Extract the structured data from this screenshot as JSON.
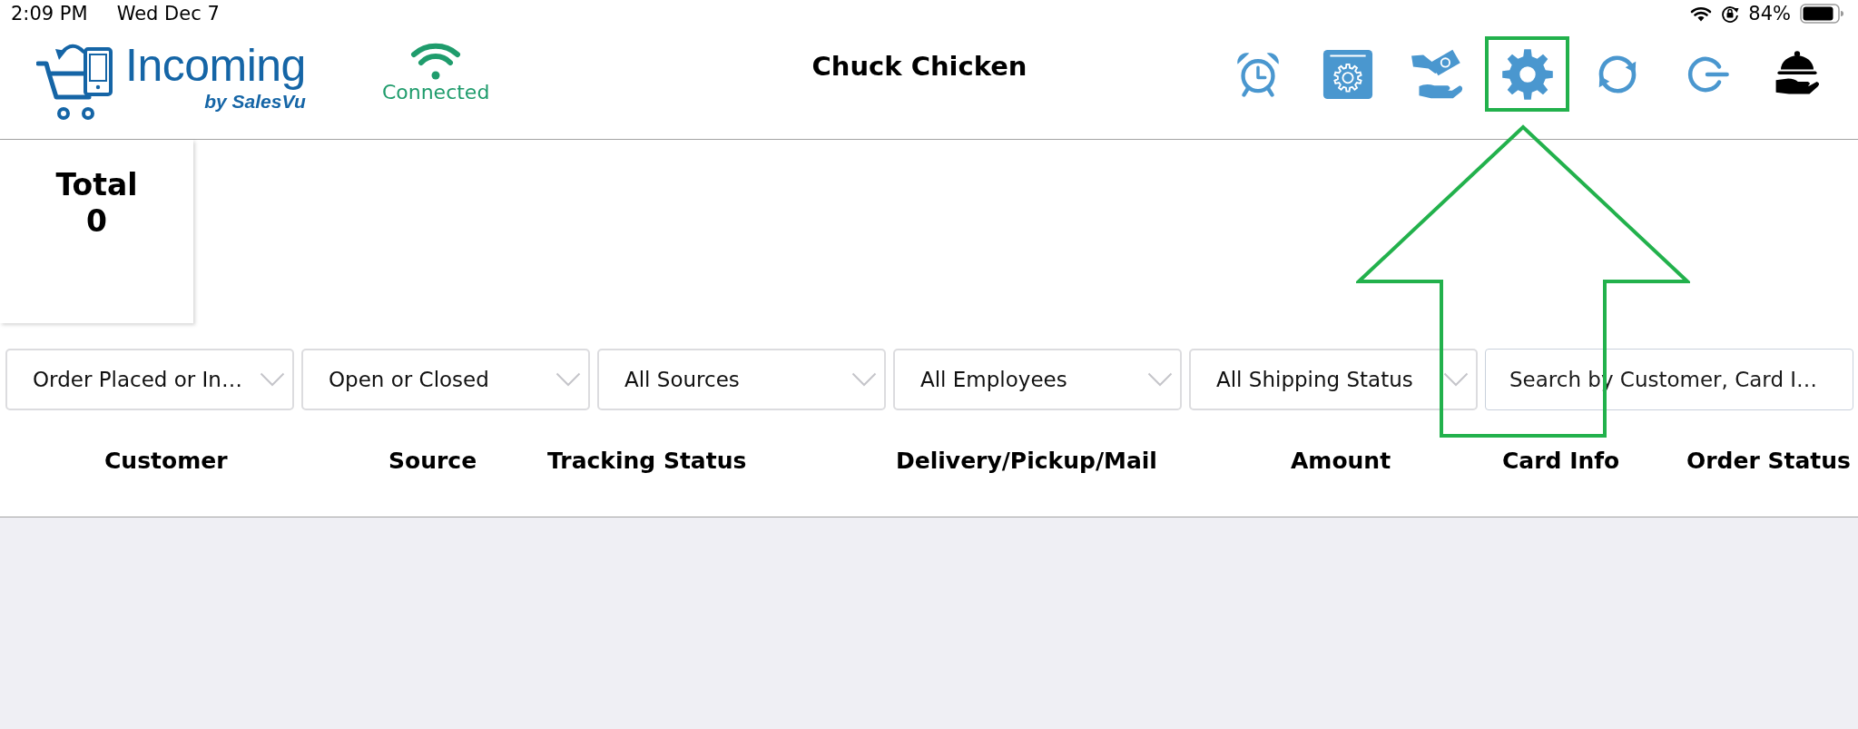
{
  "status_bar": {
    "time": "2:09 PM",
    "date": "Wed Dec 7",
    "battery": "84%"
  },
  "header": {
    "logo": {
      "name": "Incoming",
      "tagline": "by SalesVu"
    },
    "connection": {
      "label": "Connected"
    },
    "title": "Chuck Chicken",
    "toolbar": [
      {
        "kind": "alarm",
        "highlighted": false
      },
      {
        "kind": "box-settings",
        "highlighted": false
      },
      {
        "kind": "cash",
        "highlighted": false
      },
      {
        "kind": "settings",
        "highlighted": true
      },
      {
        "kind": "refresh",
        "highlighted": false
      },
      {
        "kind": "logout",
        "highlighted": false
      },
      {
        "kind": "service",
        "highlighted": false
      }
    ]
  },
  "summary": {
    "label": "Total",
    "value": "0"
  },
  "filters": [
    {
      "value": "Order Placed or In…"
    },
    {
      "value": "Open or Closed"
    },
    {
      "value": "All Sources"
    },
    {
      "value": "All Employees"
    },
    {
      "value": "All Shipping Status"
    }
  ],
  "search": {
    "placeholder": "Search by Customer, Card I…"
  },
  "table": {
    "columns": [
      "Customer",
      "Source",
      "Tracking Status",
      "Delivery/Pickup/Mail",
      "Amount",
      "Card Info",
      "Order Status"
    ]
  }
}
